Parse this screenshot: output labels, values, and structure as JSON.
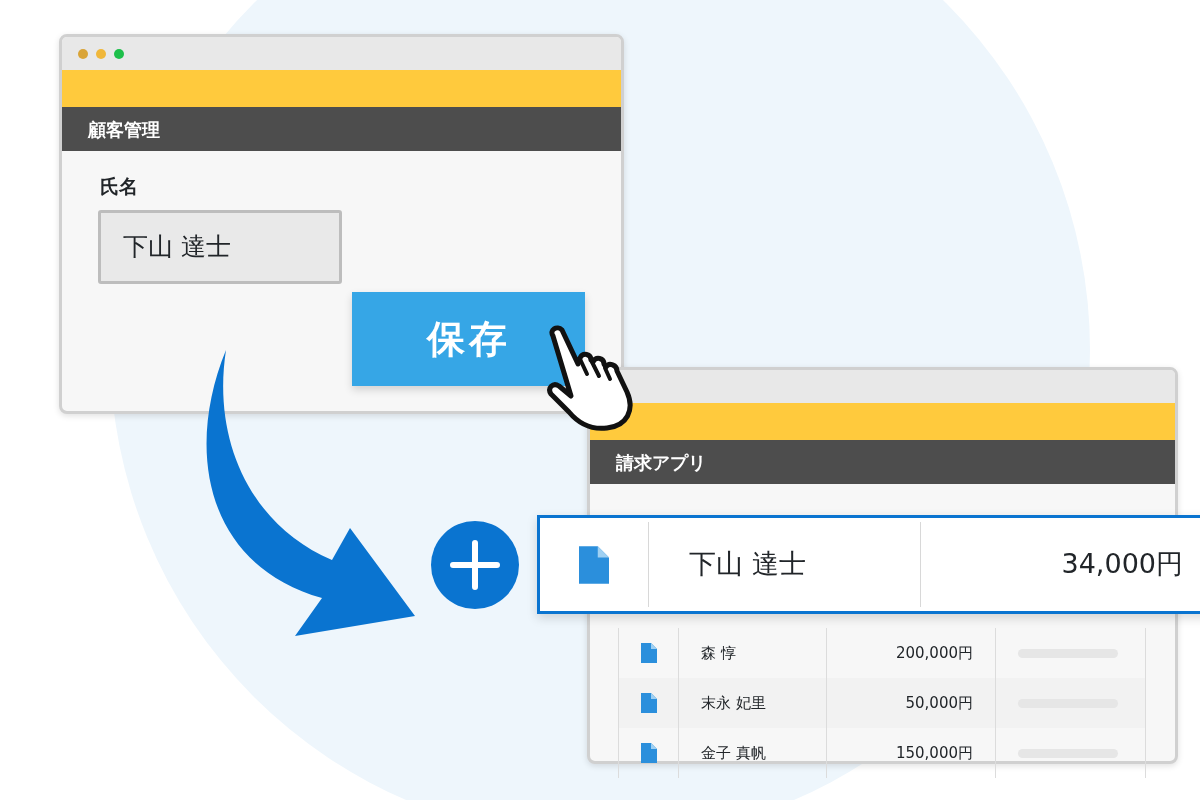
{
  "customer_window": {
    "title": "顧客管理",
    "field_label": "氏名",
    "field_value": "下山 達士",
    "save_button": "保存"
  },
  "billing_window": {
    "title": "請求アプリ",
    "new_row": {
      "name": "下山 達士",
      "amount": "34,000円"
    },
    "rows": [
      {
        "name": "森 惇",
        "amount": "200,000円"
      },
      {
        "name": "末永 妃里",
        "amount": "50,000円"
      },
      {
        "name": "金子 真帆",
        "amount": "150,000円"
      }
    ]
  }
}
